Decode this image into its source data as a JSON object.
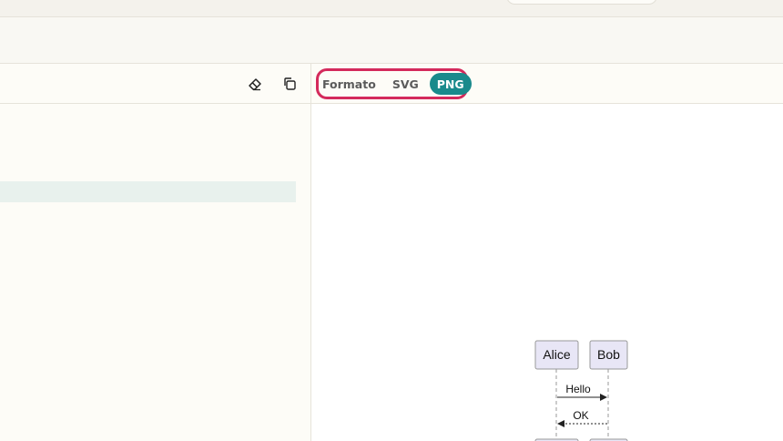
{
  "editor_toolbar": {
    "clear_icon": "eraser-icon",
    "copy_icon": "copy-icon"
  },
  "preview_toolbar": {
    "format_label": "Formato",
    "formats": [
      "SVG",
      "PNG"
    ],
    "selected_format": "PNG",
    "accent_color": "#1a8a8c",
    "highlight_color": "#d42a5c"
  },
  "diagram": {
    "participants": [
      "Alice",
      "Bob"
    ],
    "messages": [
      {
        "from": "Alice",
        "to": "Bob",
        "text": "Hello",
        "style": "solid"
      },
      {
        "from": "Bob",
        "to": "Alice",
        "text": "OK",
        "style": "dashed"
      }
    ]
  }
}
